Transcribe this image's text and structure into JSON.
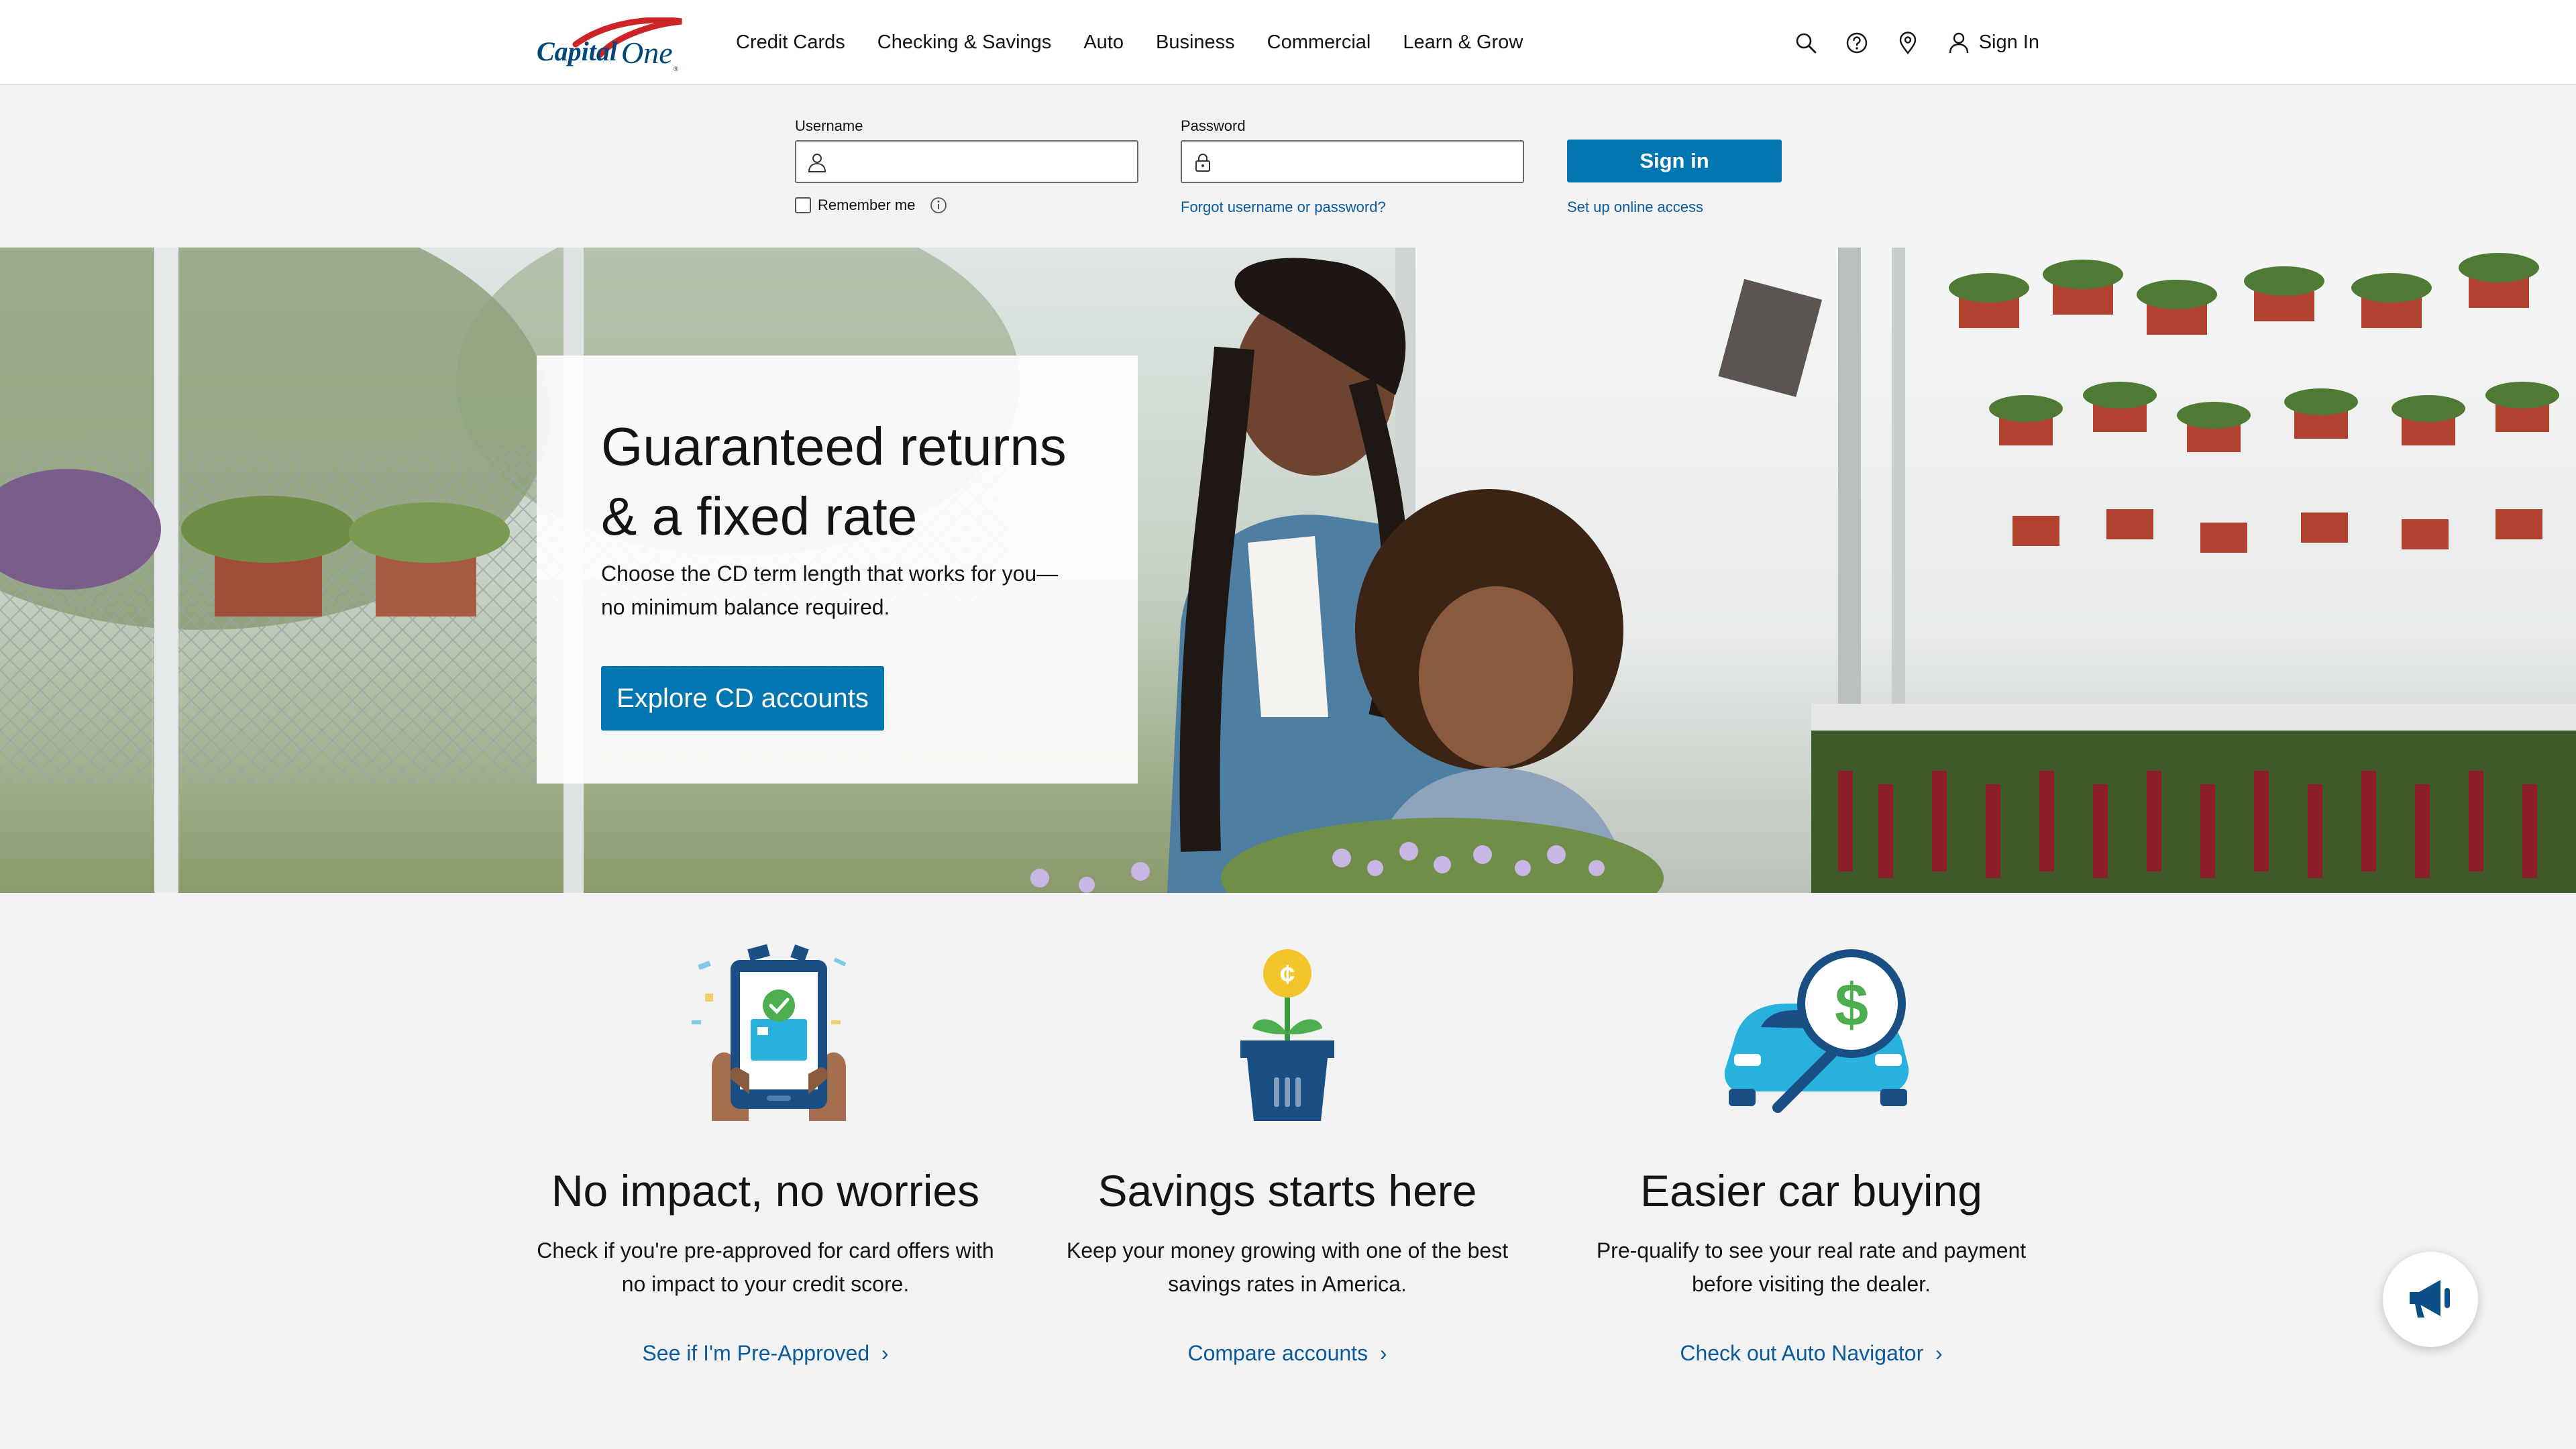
{
  "brand": {
    "logo_text": "CapitalOne",
    "accent_color": "#0276b1",
    "link_color": "#0b5a9c",
    "logo_swoosh_color": "#cc2427"
  },
  "header": {
    "nav": [
      "Credit Cards",
      "Checking & Savings",
      "Auto",
      "Business",
      "Commercial",
      "Learn & Grow"
    ],
    "icons": [
      "search-icon",
      "help-icon",
      "location-icon",
      "user-icon"
    ],
    "sign_in_label": "Sign In"
  },
  "login": {
    "username_label": "Username",
    "username_value": "",
    "password_label": "Password",
    "password_value": "",
    "remember_label": "Remember me",
    "remember_checked": false,
    "forgot_link": "Forgot username or password?",
    "signin_button": "Sign in",
    "setup_link": "Set up online access"
  },
  "hero": {
    "title_line1": "Guaranteed returns",
    "title_line2": "& a fixed rate",
    "subtitle_line1": "Choose the CD term length that works for you—",
    "subtitle_line2": "no minimum balance required.",
    "cta": "Explore CD accounts"
  },
  "features": [
    {
      "title": "No impact, no worries",
      "desc_line1": "Check if you're pre-approved for card offers with",
      "desc_line2": "no impact to your credit score.",
      "link": "See if I'm Pre-Approved",
      "icon": "phone-approval-icon"
    },
    {
      "title": "Savings starts here",
      "desc_line1": "Keep your money growing with one of the best",
      "desc_line2": "savings rates in America.",
      "link": "Compare accounts",
      "icon": "money-plant-icon"
    },
    {
      "title": "Easier car buying",
      "desc_line1": "Pre-qualify to see your real rate and payment",
      "desc_line2": "before visiting the dealer.",
      "link": "Check out Auto Navigator",
      "icon": "car-magnifier-icon"
    }
  ],
  "feedback": {
    "icon": "megaphone-icon"
  }
}
